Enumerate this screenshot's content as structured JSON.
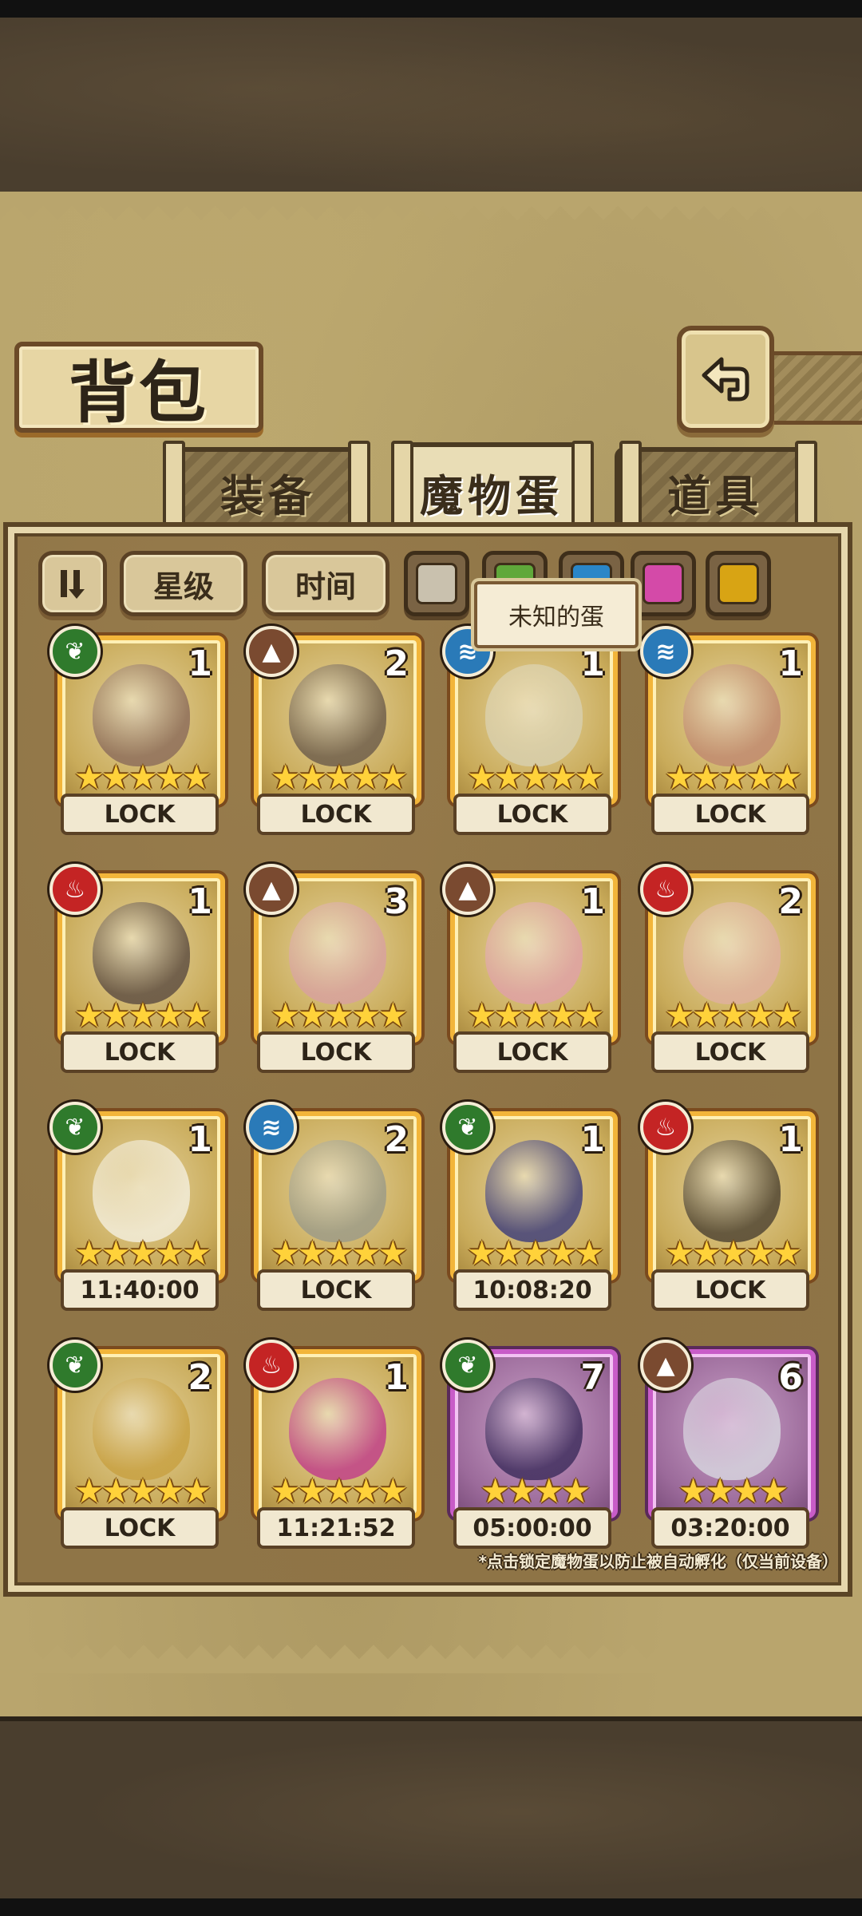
{
  "header": {
    "title": "背包"
  },
  "tabs": [
    {
      "label": "装备"
    },
    {
      "label": "魔物蛋"
    },
    {
      "label": "道具"
    }
  ],
  "filters": {
    "star_label": "星级",
    "time_label": "时间",
    "color_chips": [
      "#c9c1ae",
      "#5fa83a",
      "#2a86c8",
      "#d44aa8",
      "#d8a414"
    ]
  },
  "tooltip": {
    "text": "未知的蛋"
  },
  "eggs": [
    {
      "element": "grass",
      "count": "1",
      "stars": "★★★★★",
      "status": "LOCK",
      "rarity": "gold",
      "art": "#8a6a5a"
    },
    {
      "element": "earth",
      "count": "2",
      "stars": "★★★★★",
      "status": "LOCK",
      "rarity": "gold",
      "art": "#6a5a4a"
    },
    {
      "element": "water",
      "count": "1",
      "stars": "★★★★★",
      "status": "LOCK",
      "rarity": "gold",
      "art": "#d8d0b0"
    },
    {
      "element": "water",
      "count": "1",
      "stars": "★★★★★",
      "status": "LOCK",
      "rarity": "gold",
      "art": "#c08870"
    },
    {
      "element": "fire",
      "count": "1",
      "stars": "★★★★★",
      "status": "LOCK",
      "rarity": "gold",
      "art": "#5a4a40"
    },
    {
      "element": "earth",
      "count": "3",
      "stars": "★★★★★",
      "status": "LOCK",
      "rarity": "gold",
      "art": "#d8a0a0"
    },
    {
      "element": "earth",
      "count": "1",
      "stars": "★★★★★",
      "status": "LOCK",
      "rarity": "gold",
      "art": "#e0a0a8"
    },
    {
      "element": "fire",
      "count": "2",
      "stars": "★★★★★",
      "status": "LOCK",
      "rarity": "gold",
      "art": "#e0b0a0"
    },
    {
      "element": "grass",
      "count": "1",
      "stars": "★★★★★",
      "status": "11:40:00",
      "rarity": "gold",
      "art": "#f5f0e0"
    },
    {
      "element": "water",
      "count": "2",
      "stars": "★★★★★",
      "status": "LOCK",
      "rarity": "gold",
      "art": "#9a9a88"
    },
    {
      "element": "grass",
      "count": "1",
      "stars": "★★★★★",
      "status": "10:08:20",
      "rarity": "gold",
      "art": "#3a3a7a"
    },
    {
      "element": "fire",
      "count": "1",
      "stars": "★★★★★",
      "status": "LOCK",
      "rarity": "gold",
      "art": "#4a4030"
    },
    {
      "element": "grass",
      "count": "2",
      "stars": "★★★★★",
      "status": "LOCK",
      "rarity": "gold",
      "art": "#c8a040"
    },
    {
      "element": "fire",
      "count": "1",
      "stars": "★★★★★",
      "status": "11:21:52",
      "rarity": "gold",
      "art": "#c03a8a"
    },
    {
      "element": "grass",
      "count": "7",
      "stars": "★★★★",
      "status": "05:00:00",
      "rarity": "purple",
      "art": "#3a2a5a"
    },
    {
      "element": "earth",
      "count": "6",
      "stars": "★★★★",
      "status": "03:20:00",
      "rarity": "purple",
      "art": "#d8d8e0"
    }
  ],
  "element_icons": {
    "grass": "leaf-icon",
    "earth": "mountain-icon",
    "water": "wave-icon",
    "fire": "flame-icon"
  },
  "footer": {
    "hint": "*点击锁定魔物蛋以防止被自动孵化（仅当前设备）"
  }
}
